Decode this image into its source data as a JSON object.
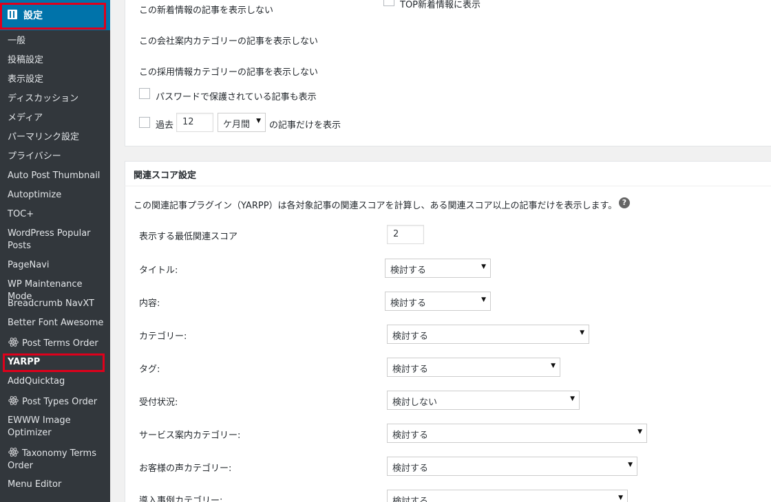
{
  "sidebar": {
    "head_title": "設定",
    "items": [
      {
        "label": "一般"
      },
      {
        "label": "投稿設定"
      },
      {
        "label": "表示設定"
      },
      {
        "label": "ディスカッション"
      },
      {
        "label": "メディア"
      },
      {
        "label": "パーマリンク設定"
      },
      {
        "label": "プライバシー"
      },
      {
        "label": "Auto Post Thumbnail"
      },
      {
        "label": "Autoptimize"
      },
      {
        "label": "TOC+"
      },
      {
        "label": "WordPress Popular Posts"
      },
      {
        "label": "PageNavi"
      },
      {
        "label": "WP Maintenance Mode"
      },
      {
        "label": "Breadcrumb NavXT"
      },
      {
        "label": "Better Font Awesome"
      },
      {
        "label": "Post Terms Order",
        "icon": "atom-icon"
      },
      {
        "label": "YARPP",
        "current": true
      },
      {
        "label": "AddQuicktag"
      },
      {
        "label": "Post Types Order",
        "icon": "atom-icon"
      },
      {
        "label": "EWWW Image Optimizer"
      },
      {
        "label": "Taxonomy Terms Order",
        "icon": "atom-icon"
      },
      {
        "label": "Menu Editor"
      }
    ]
  },
  "display_options": {
    "top_news_label": "TOP新着情報に表示",
    "hide_news": "この新着情報の記事を表示しない",
    "hide_company": "この会社案内カテゴリーの記事を表示しない",
    "hide_recruit": "この採用情報カテゴリーの記事を表示しない",
    "show_password": "パスワードで保護されている記事も表示",
    "past_label": "過去",
    "past_value": "12",
    "period_value": "ケ月間",
    "past_suffix": "の記事だけを表示"
  },
  "relevance": {
    "title": "関連スコア設定",
    "description": "この関連記事プラグイン（YARPP）は各対象記事の関連スコアを計算し、ある関連スコア以上の記事だけを表示します。",
    "help_icon": "?",
    "min_score_label": "表示する最低関連スコア",
    "min_score_value": "2",
    "rows": [
      {
        "label": "タイトル:",
        "value": "検討する"
      },
      {
        "label": "内容:",
        "value": "検討する"
      },
      {
        "label": "カテゴリー:",
        "value": "検討する"
      },
      {
        "label": "タグ:",
        "value": "検討する"
      },
      {
        "label": "受付状況:",
        "value": "検討しない"
      },
      {
        "label": "サービス案内カテゴリー:",
        "value": "検討する"
      },
      {
        "label": "お客様の声カテゴリー:",
        "value": "検討する"
      },
      {
        "label": "導入事例カテゴリー:",
        "value": "検討する"
      }
    ]
  },
  "colors": {
    "sidebar_bg": "#23282d",
    "submenu_bg": "#32373c",
    "active_blue": "#0073aa",
    "highlight_red": "#e0001b"
  }
}
